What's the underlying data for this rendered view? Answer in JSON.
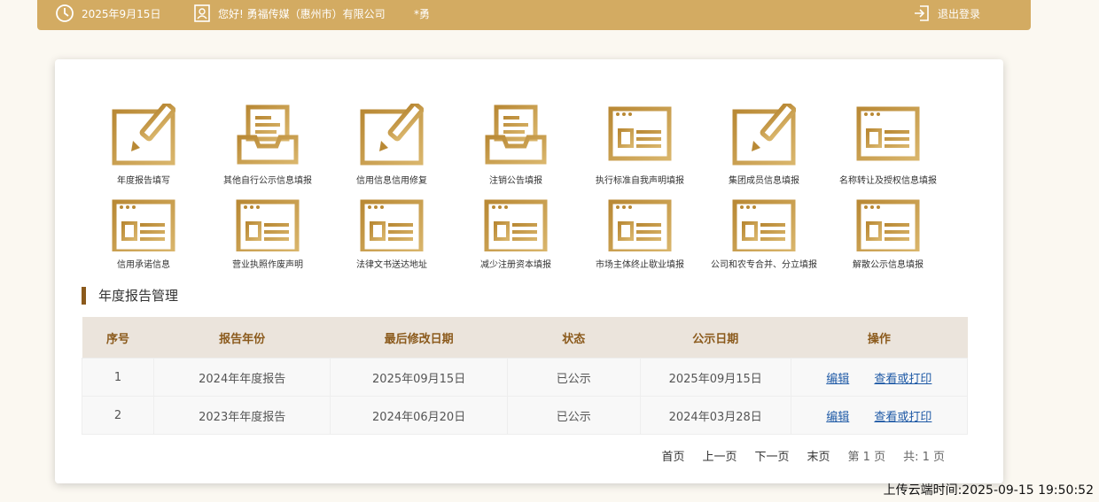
{
  "header": {
    "date": "2025年9月15日",
    "greeting": "您好! 勇福传媒（惠州市）有限公司",
    "user": "*勇",
    "logout": "退出登录"
  },
  "icons": [
    {
      "label": "年度报告填写",
      "icon": "edit-icon"
    },
    {
      "label": "其他自行公示信息填报",
      "icon": "inbox-tray-icon"
    },
    {
      "label": "信用信息信用修复",
      "icon": "edit-icon"
    },
    {
      "label": "注销公告填报",
      "icon": "inbox-tray-icon"
    },
    {
      "label": "执行标准自我声明填报",
      "icon": "browser-form-icon"
    },
    {
      "label": "集团成员信息填报",
      "icon": "edit-icon"
    },
    {
      "label": "名称转让及授权信息填报",
      "icon": "browser-form-icon"
    },
    {
      "label": "信用承诺信息",
      "icon": "browser-form-icon"
    },
    {
      "label": "营业执照作废声明",
      "icon": "browser-form-icon"
    },
    {
      "label": "法律文书送达地址",
      "icon": "browser-form-icon"
    },
    {
      "label": "减少注册资本填报",
      "icon": "browser-form-icon"
    },
    {
      "label": "市场主体终止歇业填报",
      "icon": "browser-form-icon"
    },
    {
      "label": "公司和农专合并、分立填报",
      "icon": "browser-form-icon"
    },
    {
      "label": "解散公示信息填报",
      "icon": "browser-form-icon"
    }
  ],
  "section": {
    "title": "年度报告管理"
  },
  "table": {
    "headers": [
      "序号",
      "报告年份",
      "最后修改日期",
      "状态",
      "公示日期",
      "操作"
    ],
    "rows": [
      {
        "no": "1",
        "year": "2024年年度报告",
        "modified": "2025年09月15日",
        "status": "已公示",
        "published": "2025年09月15日"
      },
      {
        "no": "2",
        "year": "2023年年度报告",
        "modified": "2024年06月20日",
        "status": "已公示",
        "published": "2024年03月28日"
      }
    ],
    "edit_label": "编辑",
    "view_label": "查看或打印"
  },
  "pager": {
    "first": "首页",
    "prev": "上一页",
    "next": "下一页",
    "last": "末页",
    "page_info": "第 1 页",
    "total_info": "共:  1 页"
  },
  "upload_time": "上传云端时间:2025-09-15 19:50:52",
  "colors": {
    "gold": "#d3ab62",
    "brown": "#8b5a1c",
    "link": "#1f5aa6"
  }
}
